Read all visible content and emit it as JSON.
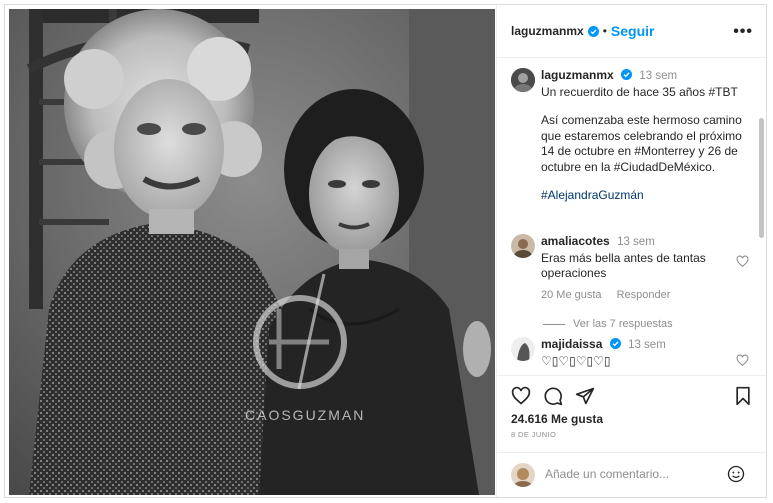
{
  "post": {
    "author": "laguzmanmx",
    "follow_label": "Seguir",
    "more_label": "•••",
    "separator": "•",
    "watermark_text": "CAOSGUZMAN"
  },
  "caption": {
    "author": "laguzmanmx",
    "time": "13 sem",
    "line1": "Un recuerdito de hace 35 años #TBT",
    "line2": "Así comenzaba este hermoso camino que estaremos celebrando el próximo 14 de octubre en #Monterrey y 26 de octubre en la #CiudadDeMéxico.",
    "hashtag": "#AlejandraGuzmán"
  },
  "comments": [
    {
      "author": "amaliacotes",
      "time": "13 sem",
      "text": "Eras más bella antes de tantas operaciones",
      "likes": "20 Me gusta",
      "reply": "Responder",
      "view_replies": "Ver las 7 respuestas"
    },
    {
      "author": "majidaissa",
      "time": "13 sem",
      "text": "♡▯♡▯♡▯♡▯"
    }
  ],
  "stats": {
    "likes": "24.616 Me gusta",
    "date": "8 DE JUNIO"
  },
  "add_comment": {
    "placeholder": "Añade un comentario..."
  },
  "colors": {
    "accent": "#0095f6",
    "verified": "#0095f6",
    "muted": "#8e8e8e"
  }
}
